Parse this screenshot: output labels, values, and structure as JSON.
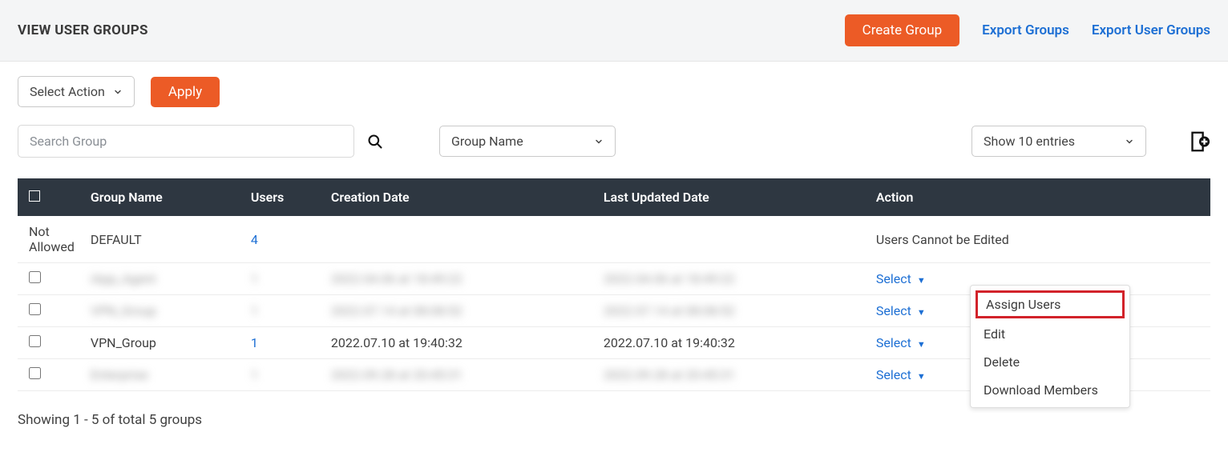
{
  "header": {
    "title": "VIEW USER GROUPS",
    "create_btn": "Create Group",
    "export_groups": "Export Groups",
    "export_user_groups": "Export User Groups"
  },
  "toolbar": {
    "select_action": "Select Action",
    "apply": "Apply"
  },
  "filters": {
    "search_placeholder": "Search Group",
    "group_name_filter": "Group Name",
    "entries_label": "Show 10 entries"
  },
  "columns": {
    "group_name": "Group Name",
    "users": "Users",
    "creation_date": "Creation Date",
    "last_updated": "Last Updated Date",
    "action": "Action"
  },
  "rows": [
    {
      "check_label": "Not Allowed",
      "group_name": "DEFAULT",
      "users": "4",
      "creation": "",
      "updated": "",
      "action": "Users Cannot be Edited",
      "blurred": false,
      "checkbox": false,
      "action_link": false
    },
    {
      "check_label": "",
      "group_name": "iApp_Agent",
      "users": "1",
      "creation": "2022.04.06 at 18:49:22",
      "updated": "2022.04.06 at 18:49:22",
      "action": "Select",
      "blurred": true,
      "checkbox": true,
      "action_link": true
    },
    {
      "check_label": "",
      "group_name": "VPN_Group",
      "users": "1",
      "creation": "2022.07.14 at 08:08:52",
      "updated": "2022.07.14 at 08:08:52",
      "action": "Select",
      "blurred": true,
      "checkbox": true,
      "action_link": true
    },
    {
      "check_label": "",
      "group_name": "VPN_Group",
      "users": "1",
      "creation": "2022.07.10 at 19:40:32",
      "updated": "2022.07.10 at 19:40:32",
      "action": "Select",
      "blurred": false,
      "checkbox": true,
      "action_link": true
    },
    {
      "check_label": "",
      "group_name": "Enterprise",
      "users": "1",
      "creation": "2022.09.28 at 20:45:31",
      "updated": "2022.09.28 at 20:45:31",
      "action": "Select",
      "blurred": true,
      "checkbox": true,
      "action_link": true
    }
  ],
  "dropdown": {
    "assign_users": "Assign Users",
    "edit": "Edit",
    "delete": "Delete",
    "download_members": "Download Members"
  },
  "footer": {
    "showing": "Showing 1 - 5 of total 5 groups"
  }
}
